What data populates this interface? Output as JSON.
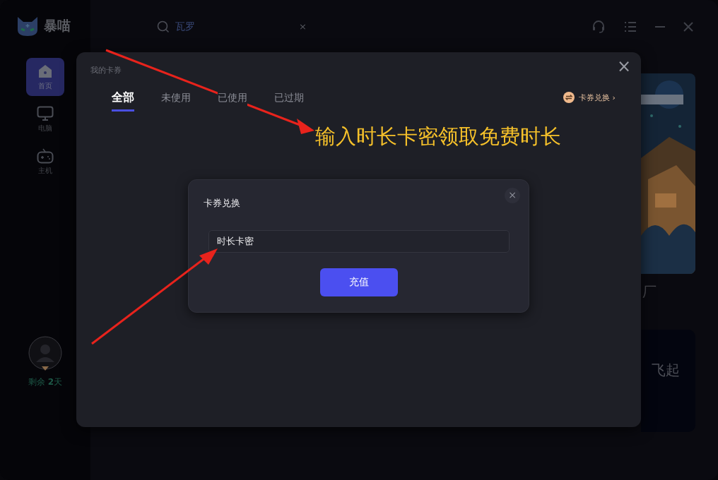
{
  "app": {
    "logo_text": "暴喵"
  },
  "search": {
    "value": "瓦罗",
    "clear": "×"
  },
  "sidebar": {
    "items": [
      {
        "label": "首页",
        "kind": "home",
        "selected": true
      },
      {
        "label": "电脑",
        "kind": "monitor",
        "selected": false
      },
      {
        "label": "主机",
        "kind": "gamepad",
        "selected": false
      }
    ],
    "remaining": "剩余 **2**天"
  },
  "background_content": {
    "card_1_text": "厂",
    "card_2_text": "飞起"
  },
  "coupon_modal": {
    "title": "我的卡券",
    "close": "×",
    "tabs": [
      {
        "label": "全部",
        "selected": true
      },
      {
        "label": "未使用",
        "selected": false
      },
      {
        "label": "已使用",
        "selected": false
      },
      {
        "label": "已过期",
        "selected": false
      }
    ],
    "redeem_link": "卡券兑换 ›"
  },
  "redeem_dialog": {
    "title": "卡券兑换",
    "close": "×",
    "input_value": "时长卡密",
    "submit": "充值"
  },
  "annotation": {
    "text": "输入时长卡密领取免费时长"
  }
}
